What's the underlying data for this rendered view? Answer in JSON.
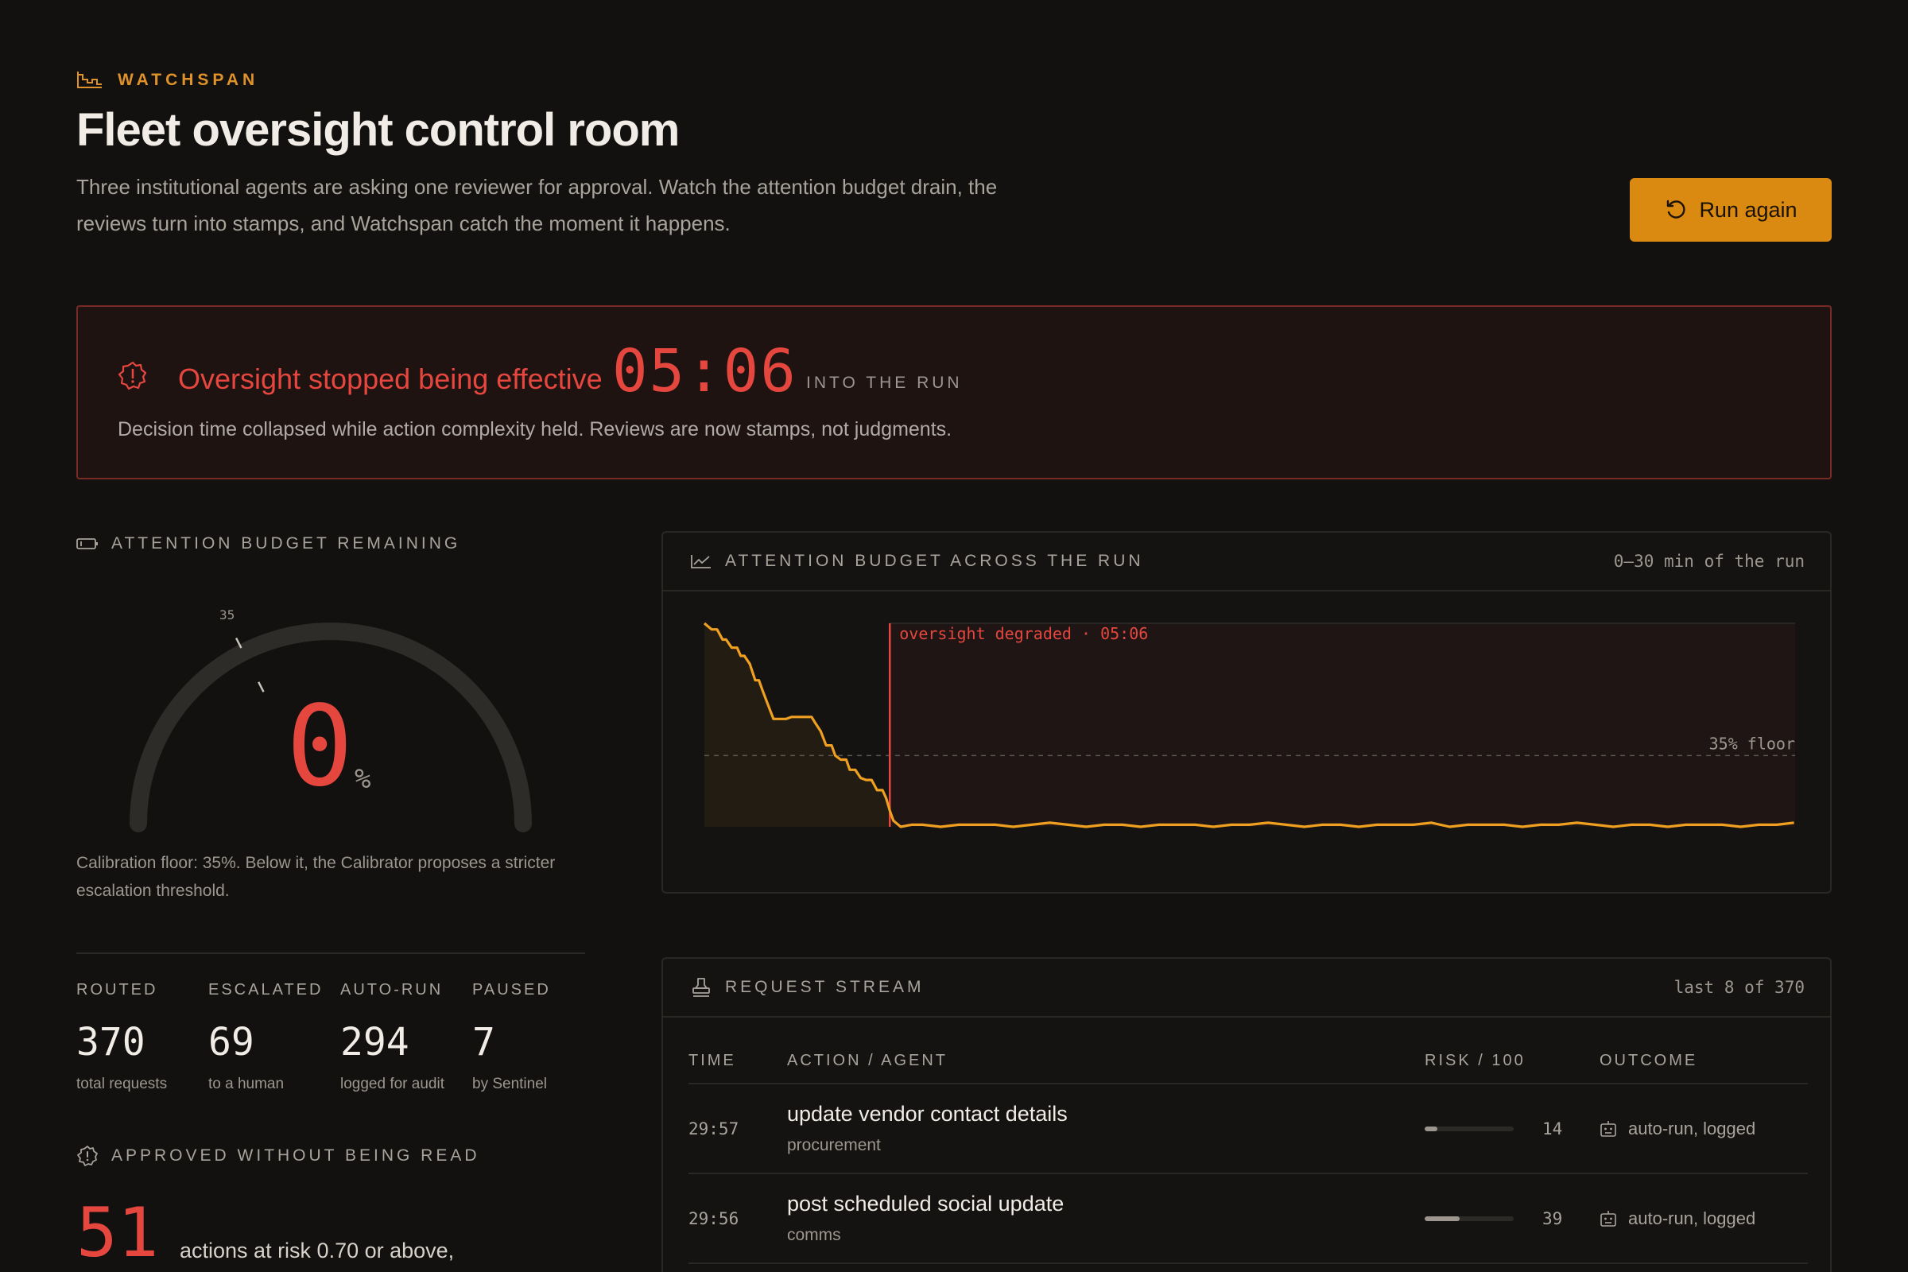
{
  "brand": {
    "label": "WATCHSPAN"
  },
  "header": {
    "title": "Fleet oversight control room",
    "subtitle": "Three institutional agents are asking one reviewer for approval. Watch the attention budget drain, the reviews turn into stamps, and Watchspan catch the moment it happens.",
    "run_again_label": "Run again"
  },
  "alert": {
    "title": "Oversight stopped being effective",
    "time": "05:06",
    "suffix": "INTO THE RUN",
    "description": "Decision time collapsed while action complexity held. Reviews are now stamps, not judgments."
  },
  "attention_budget": {
    "label": "ATTENTION BUDGET REMAINING",
    "tick_label": "35",
    "value": "0",
    "unit": "%",
    "value_fraction": 0,
    "floor_fraction": 0.35,
    "calibration_note": "Calibration floor: 35%. Below it, the Calibrator proposes a stricter escalation threshold."
  },
  "stats": [
    {
      "label": "ROUTED",
      "value": "370",
      "sub": "total requests"
    },
    {
      "label": "ESCALATED",
      "value": "69",
      "sub": "to a human"
    },
    {
      "label": "AUTO-RUN",
      "value": "294",
      "sub": "logged for audit"
    },
    {
      "label": "PAUSED",
      "value": "7",
      "sub": "by Sentinel"
    }
  ],
  "approved_unread": {
    "label": "APPROVED WITHOUT BEING READ",
    "value": "51",
    "text": "actions at risk 0.70 or above,"
  },
  "chart_card": {
    "title": "ATTENTION BUDGET ACROSS THE RUN",
    "range_note": "0–30 min of the run",
    "event_label": "oversight degraded · 05:06",
    "floor_label": "35% floor"
  },
  "chart_data": {
    "type": "line",
    "title": "ATTENTION BUDGET ACROSS THE RUN",
    "xlabel": "",
    "ylabel": "",
    "xlim": [
      0,
      30
    ],
    "ylim": [
      0,
      100
    ],
    "grid": false,
    "floor": 35,
    "event_x": 5.1,
    "series": [
      {
        "x": [
          0,
          0.2,
          0.35,
          0.5,
          0.6,
          0.75,
          0.9,
          1.0,
          1.1,
          1.25,
          1.4,
          1.5,
          1.6,
          1.75,
          1.9,
          2.0,
          2.1,
          2.25,
          2.4,
          2.5,
          2.65,
          2.8,
          2.95,
          3.05,
          3.2,
          3.35,
          3.5,
          3.6,
          3.75,
          3.9,
          4.0,
          4.15,
          4.3,
          4.45,
          4.6,
          4.75,
          4.9,
          5.0,
          5.1,
          5.2,
          5.4,
          5.7,
          6.0,
          6.5,
          7.0,
          7.5,
          8.0,
          8.5,
          9.0,
          9.5,
          10.0,
          10.5,
          11.0,
          11.5,
          12.0,
          12.5,
          13.0,
          13.5,
          14.0,
          14.5,
          15.0,
          15.5,
          16.0,
          16.5,
          17.0,
          17.5,
          18.0,
          18.5,
          19.0,
          19.5,
          20.0,
          20.5,
          21.0,
          21.5,
          22.0,
          22.5,
          23.0,
          23.5,
          24.0,
          24.5,
          25.0,
          25.5,
          26.0,
          26.5,
          27.0,
          27.5,
          28.0,
          28.5,
          29.0,
          29.5,
          29.97
        ],
        "values": [
          100,
          97,
          97,
          92,
          92,
          88,
          88,
          84,
          84,
          80,
          72,
          72,
          67,
          60,
          53,
          53,
          53,
          53,
          54,
          54,
          54,
          54,
          54,
          51,
          47,
          40,
          40,
          35,
          33,
          33,
          28,
          28,
          24,
          23,
          23,
          18,
          18,
          14,
          8,
          3,
          0,
          1,
          1,
          0,
          1,
          1,
          1,
          0,
          1,
          2,
          1,
          0,
          1,
          1,
          0,
          1,
          1,
          1,
          0,
          1,
          1,
          2,
          1,
          0,
          1,
          1,
          0,
          1,
          1,
          1,
          2,
          0,
          1,
          1,
          1,
          0,
          1,
          1,
          2,
          1,
          0,
          1,
          1,
          0,
          1,
          1,
          1,
          0,
          1,
          1,
          2
        ]
      }
    ]
  },
  "stream": {
    "title": "REQUEST STREAM",
    "range_note": "last 8 of 370",
    "columns": {
      "time": "TIME",
      "action": "ACTION / AGENT",
      "risk": "RISK / 100",
      "outcome": "OUTCOME"
    },
    "rows": [
      {
        "time": "29:57",
        "action": "update vendor contact details",
        "agent": "procurement",
        "risk": "14",
        "risk_value": 14,
        "outcome": "auto-run, logged"
      },
      {
        "time": "29:56",
        "action": "post scheduled social update",
        "agent": "comms",
        "risk": "39",
        "risk_value": 39,
        "outcome": "auto-run, logged"
      }
    ]
  },
  "colors": {
    "accent": "#da8a10",
    "danger": "#e5473f",
    "line": "#f0a020"
  },
  "icons": [
    "watchspan-logo-icon",
    "refresh-icon",
    "alert-badge-icon",
    "battery-icon",
    "chart-line-icon",
    "stamp-icon",
    "robot-icon"
  ]
}
